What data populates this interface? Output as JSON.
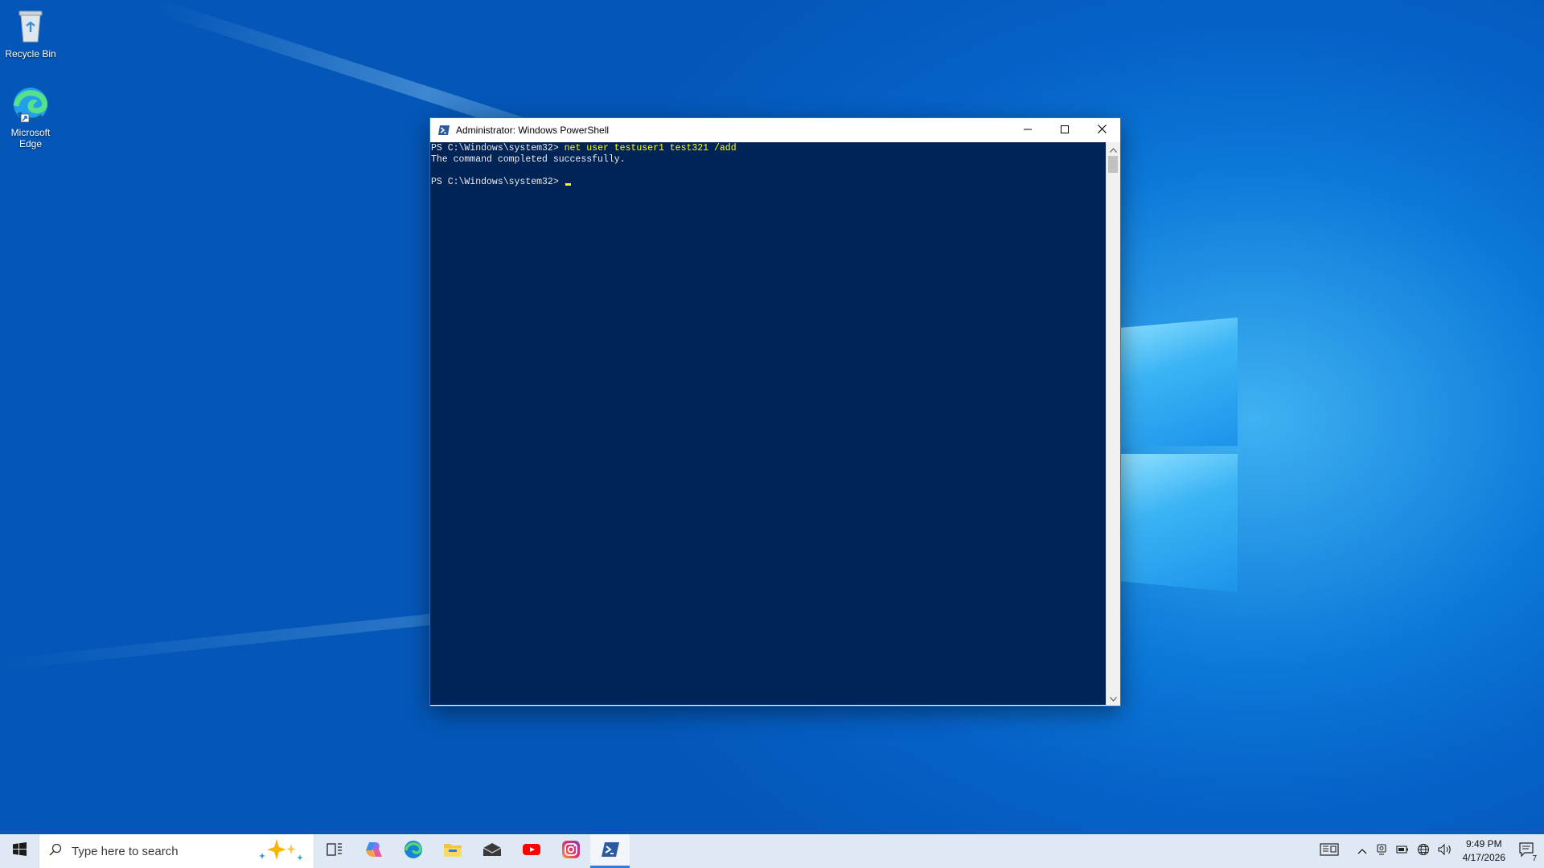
{
  "desktop": {
    "icons": [
      {
        "label": "Recycle Bin"
      },
      {
        "label": "Microsoft Edge"
      }
    ]
  },
  "window": {
    "title": "Administrator: Windows PowerShell",
    "controls": {
      "minimize": "minimize",
      "maximize": "maximize",
      "close": "close"
    }
  },
  "console": {
    "lines": [
      {
        "prompt": "PS C:\\Windows\\system32> ",
        "command": "net",
        "args": " user testuser1 test321 /add"
      },
      {
        "output": "The command completed successfully."
      },
      {
        "output": ""
      },
      {
        "prompt": "PS C:\\Windows\\system32> ",
        "command": "",
        "args": ""
      }
    ],
    "colors": {
      "background": "#012456",
      "text": "#eeedf0",
      "command": "#ffff00"
    }
  },
  "taskbar": {
    "search_placeholder": "Type here to search",
    "apps": [
      "task-view",
      "copilot",
      "microsoft-edge",
      "file-explorer",
      "mail",
      "youtube",
      "instagram",
      "windows-powershell"
    ],
    "active_app": "windows-powershell"
  },
  "tray": {
    "time": "9:49 PM",
    "date": "4/17/2026",
    "notification_count": "7"
  }
}
